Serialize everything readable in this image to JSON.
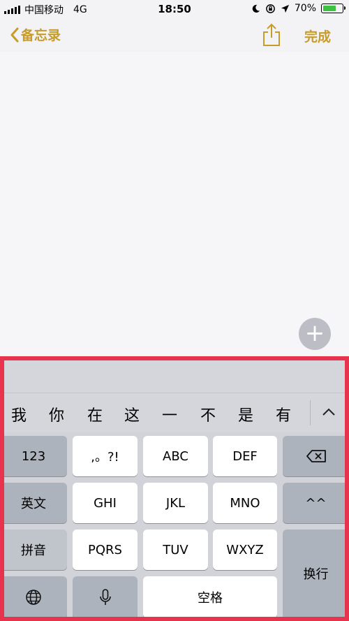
{
  "status_bar": {
    "carrier": "中国移动",
    "network": "4G",
    "time": "18:50",
    "battery_percent": "70%",
    "battery_level": 0.7
  },
  "nav": {
    "back_label": "备忘录",
    "done_label": "完成"
  },
  "keyboard": {
    "candidates": [
      "我",
      "你",
      "在",
      "这",
      "一",
      "不",
      "是",
      "有"
    ],
    "keys": {
      "numbers": "123",
      "punctuation": ",。?!",
      "abc": "ABC",
      "def": "DEF",
      "english": "英文",
      "ghi": "GHI",
      "jkl": "JKL",
      "mno": "MNO",
      "emoji": "^^",
      "pinyin": "拼音",
      "pqrs": "PQRS",
      "tuv": "TUV",
      "wxyz": "WXYZ",
      "return": "换行",
      "space": "空格"
    }
  },
  "colors": {
    "accent": "#c79c2a",
    "highlight_border": "#e8334e",
    "battery_fill": "#3cc140"
  }
}
